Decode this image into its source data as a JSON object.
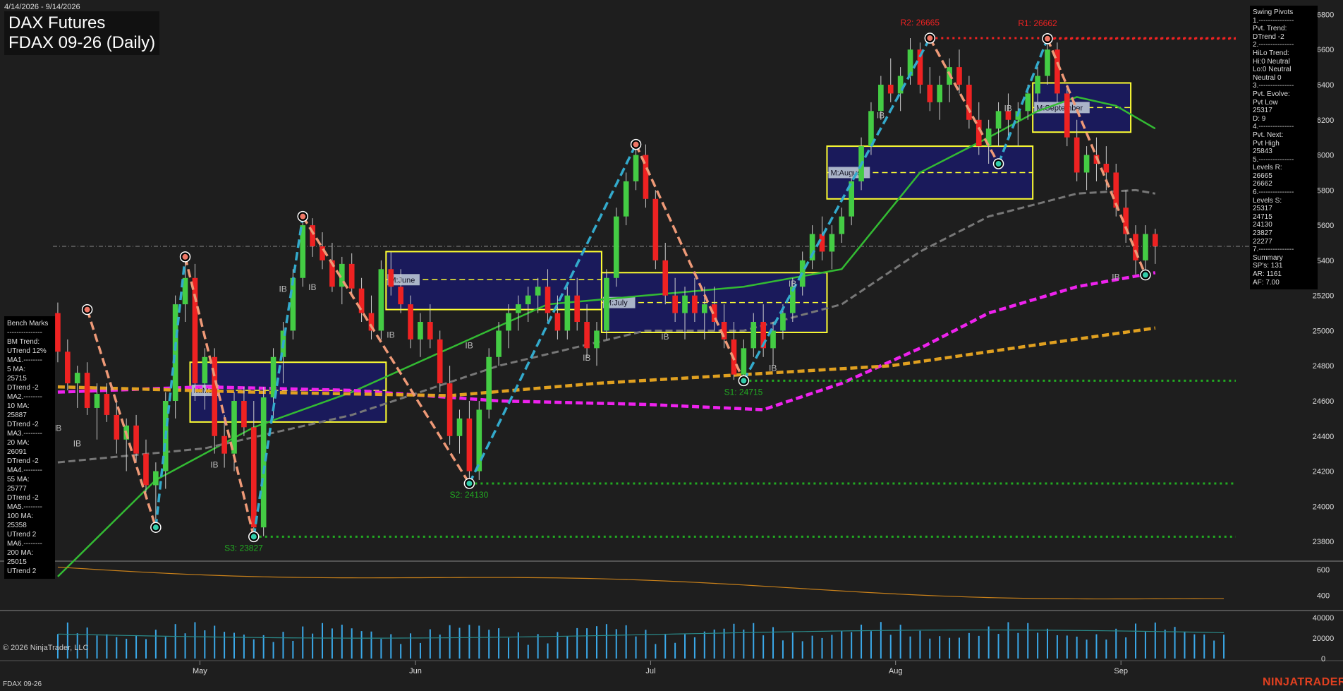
{
  "header": {
    "date_range": "4/14/2026 - 9/14/2026",
    "instrument": "DAX Futures",
    "contract": "FDAX 09-26 (Daily)"
  },
  "footer": {
    "copyright": "© 2026 NinjaTrader, LLC",
    "symbol": "FDAX 09-26",
    "brand": "NINJATRADER"
  },
  "benchmarks": [
    "Bench Marks",
    "---------------",
    "BM Trend:",
    "UTrend 12%",
    "MA1.--------",
    "5 MA:",
    "25715",
    "DTrend -2",
    "MA2.--------",
    "10 MA:",
    "25887",
    "DTrend -2",
    "MA3.--------",
    "20 MA:",
    "26091",
    "DTrend -2",
    "MA4.--------",
    "55 MA:",
    "25777",
    "DTrend -2",
    "MA5.--------",
    "100 MA:",
    "25358",
    "UTrend 2",
    "MA6.--------",
    "200 MA:",
    "25015",
    "UTrend 2"
  ],
  "swing_pivots": [
    "Swing Pivots",
    "1.---------------",
    "Pvt. Trend:",
    "DTrend -2",
    "2.---------------",
    "HiLo Trend:",
    "Hi:0 Neutral",
    "Lo:0 Neutral",
    "Neutral 0",
    "3.---------------",
    "Pvt. Evolve:",
    "Pvt Low",
    "25317",
    "D: 9",
    "4.---------------",
    "Pvt. Next:",
    "Pvt High",
    "25843",
    "5.---------------",
    "Levels R:",
    "26665",
    "26662",
    "6.---------------",
    "Levels S:",
    "25317",
    "24715",
    "24130",
    "23827",
    "22277",
    "7.---------------",
    "Summary",
    "SP's: 131",
    "AR: 1161",
    "AF: 7.00"
  ],
  "colors": {
    "up": "#44cc44",
    "down": "#ee2222",
    "ma_green": "#33bb33",
    "ma_gray": "#777777",
    "ma_magenta": "#ee22ee",
    "ma_orange": "#e0a020",
    "pivot_up": "#33aacc",
    "pivot_down": "#ee9977",
    "box": "#ffff33",
    "box_fill": "#1a1a66"
  },
  "chart_data": {
    "type": "candlestick",
    "title": "FDAX 09-26 (Daily)",
    "ylim": [
      23700,
      26850
    ],
    "yticks": [
      23800,
      24000,
      24200,
      24400,
      24600,
      24800,
      25000,
      25200,
      25400,
      25600,
      25800,
      26000,
      26200,
      26400,
      26600,
      26800
    ],
    "x_labels": [
      {
        "label": "May",
        "index": 15
      },
      {
        "label": "Jun",
        "index": 37
      },
      {
        "label": "Jul",
        "index": 61
      },
      {
        "label": "Aug",
        "index": 86
      },
      {
        "label": "Sep",
        "index": 109
      }
    ],
    "n_bars": 120,
    "ohlc": [
      [
        25100,
        25160,
        24820,
        24880
      ],
      [
        24880,
        24950,
        24660,
        24700
      ],
      [
        24700,
        24800,
        24560,
        24760
      ],
      [
        24760,
        24820,
        24520,
        24560
      ],
      [
        24560,
        24700,
        24380,
        24640
      ],
      [
        24640,
        24700,
        24480,
        24520
      ],
      [
        24520,
        24600,
        24300,
        24380
      ],
      [
        24380,
        24500,
        24200,
        24460
      ],
      [
        24460,
        24520,
        24250,
        24300
      ],
      [
        24300,
        24380,
        24080,
        24120
      ],
      [
        24120,
        24250,
        23880,
        24200
      ],
      [
        24200,
        24650,
        24100,
        24600
      ],
      [
        24600,
        25200,
        24500,
        25150
      ],
      [
        25150,
        25420,
        25050,
        25300
      ],
      [
        25300,
        25380,
        24600,
        24700
      ],
      [
        24700,
        24900,
        24550,
        24850
      ],
      [
        24850,
        24900,
        24300,
        24400
      ],
      [
        24400,
        24520,
        24220,
        24300
      ],
      [
        24300,
        24650,
        24200,
        24600
      ],
      [
        24600,
        24680,
        24400,
        24450
      ],
      [
        24450,
        24600,
        23820,
        23880
      ],
      [
        23880,
        24680,
        23830,
        24620
      ],
      [
        24620,
        24900,
        24500,
        24850
      ],
      [
        24850,
        25050,
        24700,
        25000
      ],
      [
        25000,
        25350,
        24950,
        25300
      ],
      [
        25300,
        25650,
        25250,
        25600
      ],
      [
        25600,
        25640,
        25420,
        25480
      ],
      [
        25480,
        25560,
        25350,
        25400
      ],
      [
        25400,
        25500,
        25220,
        25250
      ],
      [
        25250,
        25420,
        25150,
        25380
      ],
      [
        25380,
        25440,
        25200,
        25240
      ],
      [
        25240,
        25300,
        25050,
        25100
      ],
      [
        25100,
        25200,
        24950,
        25000
      ],
      [
        25000,
        25400,
        24950,
        25350
      ],
      [
        25350,
        25450,
        25200,
        25250
      ],
      [
        25250,
        25350,
        25100,
        25150
      ],
      [
        25150,
        25200,
        24900,
        24950
      ],
      [
        24950,
        25100,
        24850,
        25050
      ],
      [
        25050,
        25150,
        24900,
        24950
      ],
      [
        24950,
        25000,
        24650,
        24700
      ],
      [
        24700,
        24800,
        24350,
        24400
      ],
      [
        24400,
        24550,
        24300,
        24500
      ],
      [
        24500,
        24600,
        24150,
        24200
      ],
      [
        24200,
        24600,
        24150,
        24550
      ],
      [
        24550,
        24900,
        24500,
        24850
      ],
      [
        24850,
        25050,
        24800,
        25000
      ],
      [
        25000,
        25150,
        24900,
        25100
      ],
      [
        25100,
        25200,
        25000,
        25150
      ],
      [
        25150,
        25250,
        25050,
        25200
      ],
      [
        25200,
        25300,
        25100,
        25250
      ],
      [
        25250,
        25350,
        25050,
        25100
      ],
      [
        25100,
        25200,
        24950,
        25000
      ],
      [
        25000,
        25250,
        24950,
        25200
      ],
      [
        25200,
        25300,
        25000,
        25050
      ],
      [
        25050,
        25150,
        24850,
        24900
      ],
      [
        24900,
        25050,
        24800,
        25000
      ],
      [
        25000,
        25350,
        24950,
        25300
      ],
      [
        25300,
        25700,
        25250,
        25650
      ],
      [
        25650,
        25900,
        25600,
        25850
      ],
      [
        25850,
        26050,
        25800,
        26000
      ],
      [
        26000,
        26060,
        25700,
        25750
      ],
      [
        25750,
        25800,
        25350,
        25400
      ],
      [
        25400,
        25500,
        25150,
        25200
      ],
      [
        25200,
        25300,
        25050,
        25100
      ],
      [
        25100,
        25250,
        24950,
        25200
      ],
      [
        25200,
        25300,
        25050,
        25100
      ],
      [
        25100,
        25250,
        24950,
        25150
      ],
      [
        25150,
        25250,
        25000,
        25050
      ],
      [
        25050,
        25150,
        24900,
        24950
      ],
      [
        24950,
        25050,
        24720,
        24750
      ],
      [
        24750,
        24950,
        24720,
        24900
      ],
      [
        24900,
        25100,
        24850,
        25050
      ],
      [
        25050,
        25150,
        24850,
        24900
      ],
      [
        24900,
        25050,
        24800,
        25000
      ],
      [
        25000,
        25150,
        24950,
        25100
      ],
      [
        25100,
        25300,
        25050,
        25250
      ],
      [
        25250,
        25450,
        25200,
        25400
      ],
      [
        25400,
        25600,
        25350,
        25550
      ],
      [
        25550,
        25650,
        25400,
        25450
      ],
      [
        25450,
        25600,
        25350,
        25550
      ],
      [
        25550,
        25700,
        25500,
        25650
      ],
      [
        25650,
        25900,
        25600,
        25850
      ],
      [
        25850,
        26100,
        25800,
        26050
      ],
      [
        26050,
        26300,
        26000,
        26250
      ],
      [
        26250,
        26450,
        26200,
        26400
      ],
      [
        26400,
        26550,
        26300,
        26350
      ],
      [
        26350,
        26500,
        26250,
        26450
      ],
      [
        26450,
        26665,
        26400,
        26600
      ],
      [
        26600,
        26640,
        26350,
        26400
      ],
      [
        26400,
        26500,
        26250,
        26300
      ],
      [
        26300,
        26450,
        26200,
        26400
      ],
      [
        26400,
        26550,
        26300,
        26500
      ],
      [
        26500,
        26600,
        26350,
        26400
      ],
      [
        26400,
        26450,
        26150,
        26200
      ],
      [
        26200,
        26300,
        26000,
        26050
      ],
      [
        26050,
        26200,
        25950,
        26150
      ],
      [
        26150,
        26300,
        26050,
        26250
      ],
      [
        26250,
        26350,
        26100,
        26200
      ],
      [
        26200,
        26300,
        26050,
        26250
      ],
      [
        26250,
        26400,
        26200,
        26350
      ],
      [
        26350,
        26500,
        26300,
        26450
      ],
      [
        26450,
        26662,
        26400,
        26600
      ],
      [
        26600,
        26640,
        26300,
        26350
      ],
      [
        26350,
        26400,
        26050,
        26100
      ],
      [
        26100,
        26200,
        25850,
        25900
      ],
      [
        25900,
        26050,
        25800,
        26000
      ],
      [
        26000,
        26100,
        25850,
        25950
      ],
      [
        25950,
        26050,
        25800,
        25900
      ],
      [
        25900,
        25950,
        25650,
        25700
      ],
      [
        25700,
        25800,
        25500,
        25550
      ],
      [
        25550,
        25600,
        25320,
        25400
      ],
      [
        25400,
        25600,
        25317,
        25550
      ],
      [
        25550,
        25580,
        25380,
        25480
      ]
    ],
    "moving_averages": [
      {
        "name": "20 MA",
        "color": "#33bb33",
        "points": [
          [
            0,
            23600
          ],
          [
            10,
            24150
          ],
          [
            20,
            24450
          ],
          [
            30,
            24650
          ],
          [
            40,
            24900
          ],
          [
            50,
            25150
          ],
          [
            60,
            25200
          ],
          [
            70,
            25250
          ],
          [
            80,
            25350
          ],
          [
            88,
            25900
          ],
          [
            95,
            26100
          ],
          [
            100,
            26250
          ],
          [
            104,
            26330
          ],
          [
            108,
            26280
          ],
          [
            112,
            26150
          ]
        ]
      },
      {
        "name": "55 MA",
        "color": "#777777",
        "points": [
          [
            0,
            24250
          ],
          [
            15,
            24330
          ],
          [
            30,
            24520
          ],
          [
            45,
            24800
          ],
          [
            60,
            25000
          ],
          [
            70,
            25000
          ],
          [
            80,
            25150
          ],
          [
            88,
            25450
          ],
          [
            95,
            25650
          ],
          [
            104,
            25780
          ],
          [
            110,
            25800
          ],
          [
            112,
            25780
          ]
        ]
      },
      {
        "name": "100 MA",
        "color": "#ee22ee",
        "points": [
          [
            0,
            24650
          ],
          [
            15,
            24680
          ],
          [
            30,
            24660
          ],
          [
            45,
            24600
          ],
          [
            60,
            24580
          ],
          [
            72,
            24550
          ],
          [
            80,
            24700
          ],
          [
            88,
            24900
          ],
          [
            95,
            25100
          ],
          [
            104,
            25250
          ],
          [
            112,
            25330
          ]
        ]
      },
      {
        "name": "200 MA",
        "color": "#e0a020",
        "points": [
          [
            0,
            24680
          ],
          [
            20,
            24650
          ],
          [
            40,
            24630
          ],
          [
            55,
            24700
          ],
          [
            70,
            24750
          ],
          [
            85,
            24800
          ],
          [
            100,
            24920
          ],
          [
            112,
            25015
          ]
        ]
      }
    ],
    "pivots": [
      {
        "index": 3,
        "price": 25120,
        "type": "high"
      },
      {
        "index": 10,
        "price": 23880,
        "type": "low"
      },
      {
        "index": 13,
        "price": 25420,
        "type": "high"
      },
      {
        "index": 20,
        "price": 23827,
        "type": "low"
      },
      {
        "index": 25,
        "price": 25650,
        "type": "high"
      },
      {
        "index": 42,
        "price": 24130,
        "type": "low"
      },
      {
        "index": 59,
        "price": 26060,
        "type": "high"
      },
      {
        "index": 70,
        "price": 24715,
        "type": "low"
      },
      {
        "index": 89,
        "price": 26665,
        "type": "high"
      },
      {
        "index": 96,
        "price": 25950,
        "type": "low"
      },
      {
        "index": 101,
        "price": 26662,
        "type": "high"
      },
      {
        "index": 111,
        "price": 25317,
        "type": "low"
      }
    ],
    "levels": [
      {
        "label": "R2: 26665",
        "price": 26665,
        "kind": "resistance",
        "start": 89,
        "label_index": 86
      },
      {
        "label": "R1: 26662",
        "price": 26662,
        "kind": "resistance",
        "start": 101,
        "label_index": 98
      },
      {
        "label": "S1: 24715",
        "price": 24715,
        "kind": "support",
        "start": 70,
        "label_index": 68
      },
      {
        "label": "S2: 24130",
        "price": 24130,
        "kind": "support",
        "start": 42,
        "label_index": 40
      },
      {
        "label": "S3: 23827",
        "price": 23827,
        "kind": "support",
        "start": 20,
        "label_index": 17
      }
    ],
    "monthly_boxes": [
      {
        "label": "M:May",
        "i0": 14,
        "i1": 33,
        "hi": 24820,
        "lo": 24480,
        "mid": 24660
      },
      {
        "label": "M:June",
        "i0": 34,
        "i1": 55,
        "hi": 25450,
        "lo": 25120,
        "mid": 25290
      },
      {
        "label": "M:July",
        "i0": 56,
        "i1": 78,
        "hi": 25330,
        "lo": 24990,
        "mid": 25160
      },
      {
        "label": "M:August",
        "i0": 79,
        "i1": 99,
        "hi": 26050,
        "lo": 25750,
        "mid": 25900
      },
      {
        "label": "M:September",
        "i0": 100,
        "i1": 109,
        "hi": 26410,
        "lo": 26130,
        "mid": 26270
      }
    ],
    "ib_labels": [
      {
        "index": 0,
        "price": 24430
      },
      {
        "index": 2,
        "price": 24340
      },
      {
        "index": 16,
        "price": 24220
      },
      {
        "index": 23,
        "price": 25220
      },
      {
        "index": 26,
        "price": 25230
      },
      {
        "index": 34,
        "price": 24960
      },
      {
        "index": 42,
        "price": 24900
      },
      {
        "index": 54,
        "price": 24830
      },
      {
        "index": 62,
        "price": 24950
      },
      {
        "index": 73,
        "price": 24770
      },
      {
        "index": 75,
        "price": 25250
      },
      {
        "index": 84,
        "price": 26210
      },
      {
        "index": 97,
        "price": 26250
      },
      {
        "index": 108,
        "price": 25290
      }
    ],
    "last_price": 25480,
    "indicator1": {
      "yticks": [
        400,
        600
      ],
      "ylim": [
        300,
        650
      ]
    },
    "indicator2": {
      "yticks": [
        0,
        20000,
        40000
      ],
      "ylim": [
        0,
        45000
      ]
    }
  }
}
